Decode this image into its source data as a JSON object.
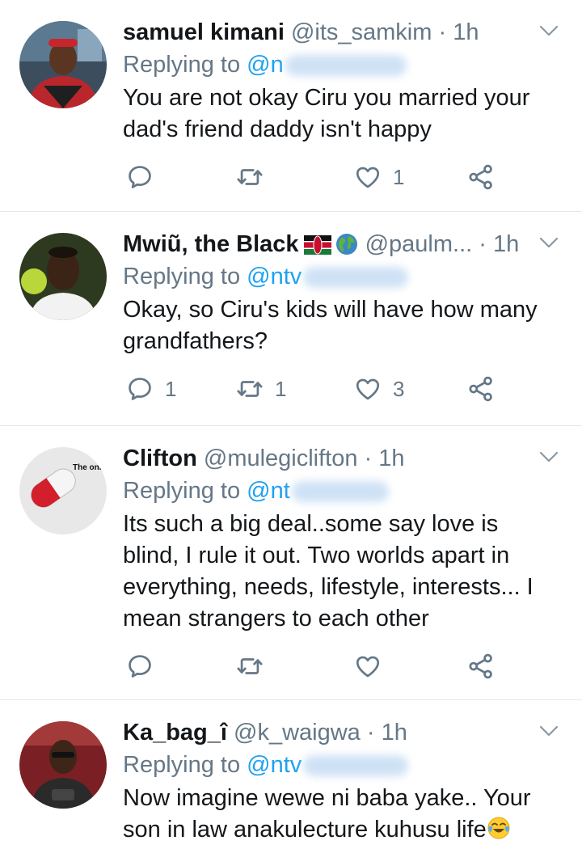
{
  "colors": {
    "text": "#14171a",
    "meta": "#657786",
    "accent": "#1da1f2",
    "divider": "#e1e8ed"
  },
  "tweets": [
    {
      "name": "samuel kimani",
      "handle": "@its_samkim",
      "time": "1h",
      "replying_label": "Replying to",
      "mention": "@n",
      "text": "You are not okay Ciru you married your dad's friend daddy isn't happy",
      "reply_count": "",
      "retweet_count": "",
      "like_count": "1"
    },
    {
      "name": "Mwiũ, the Black",
      "handle": "@paulm...",
      "time": "1h",
      "replying_label": "Replying to",
      "mention": "@ntv",
      "text": "Okay, so Ciru's kids will have how many grandfathers?",
      "reply_count": "1",
      "retweet_count": "1",
      "like_count": "3"
    },
    {
      "name": "Clifton",
      "handle": "@mulegiclifton",
      "time": "1h",
      "replying_label": "Replying to",
      "mention": "@nt",
      "text": "Its such a big deal..some say love is blind, I rule it out. Two worlds apart in everything, needs, lifestyle, interests... I mean strangers to each other",
      "avatar_text": "The only medicine found till now",
      "reply_count": "",
      "retweet_count": "",
      "like_count": ""
    },
    {
      "name": "Ka_bag_î",
      "handle": "@k_waigwa",
      "time": "1h",
      "replying_label": "Replying to",
      "mention": "@ntv",
      "text": "Now imagine wewe ni baba yake.. Your son in law anakulecture kuhusu life"
    }
  ]
}
